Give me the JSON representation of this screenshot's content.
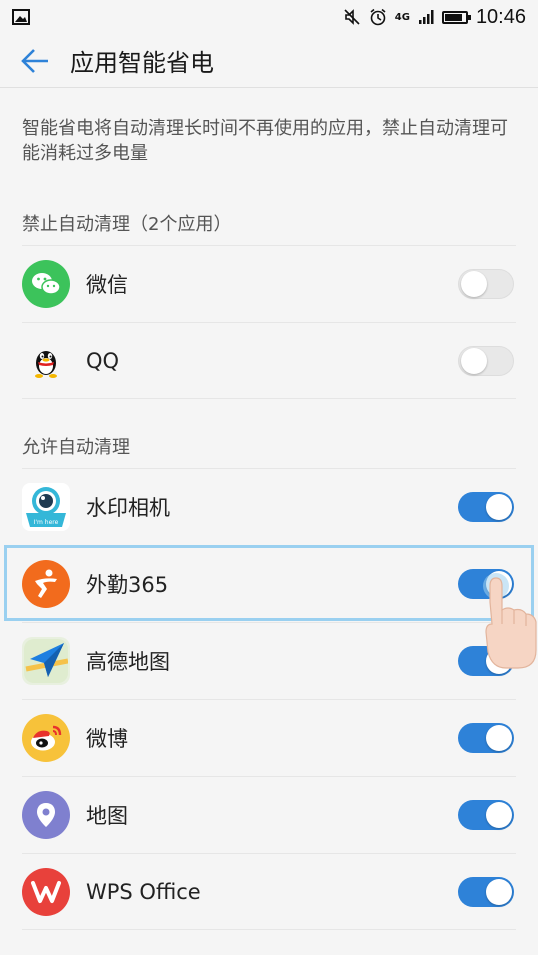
{
  "status_bar": {
    "network": "4G",
    "time": "10:46",
    "battery_level": 0.85,
    "icons": [
      "image-icon",
      "mute-icon",
      "alarm-icon",
      "signal-icon",
      "battery-icon"
    ]
  },
  "header": {
    "title": "应用智能省电",
    "back_icon": "arrow-left-icon"
  },
  "description": "智能省电将自动清理长时间不再使用的应用，禁止自动清理可能消耗过多电量",
  "sections": [
    {
      "title": "禁止自动清理（2个应用）",
      "apps": [
        {
          "name": "微信",
          "icon": "wechat-icon",
          "enabled": false
        },
        {
          "name": "QQ",
          "icon": "qq-icon",
          "enabled": false
        }
      ]
    },
    {
      "title": "允许自动清理",
      "apps": [
        {
          "name": "水印相机",
          "icon": "watermark-camera-icon",
          "enabled": true
        },
        {
          "name": "外勤365",
          "icon": "waiqin365-icon",
          "enabled": true,
          "highlighted": true
        },
        {
          "name": "高德地图",
          "icon": "amap-icon",
          "enabled": true
        },
        {
          "name": "微博",
          "icon": "weibo-icon",
          "enabled": true
        },
        {
          "name": "地图",
          "icon": "maps-icon",
          "enabled": true
        },
        {
          "name": "WPS Office",
          "icon": "wps-office-icon",
          "enabled": true
        }
      ]
    }
  ],
  "colors": {
    "accent": "#2e82d8",
    "highlight_border": "#9ad0f0",
    "background": "#f5f5f5"
  }
}
